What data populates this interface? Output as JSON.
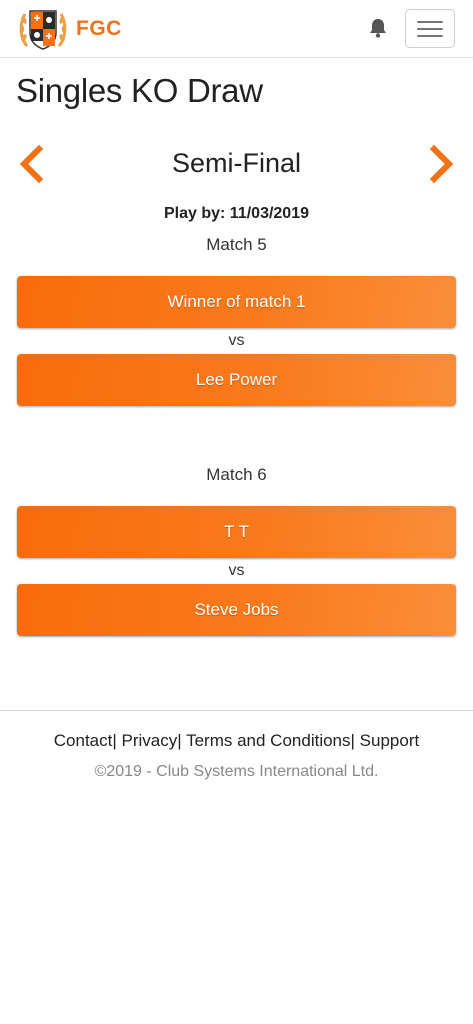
{
  "header": {
    "brand": "FGC",
    "notifications_icon": "bell-icon",
    "menu_icon": "hamburger-menu-icon"
  },
  "page": {
    "title": "Singles KO Draw"
  },
  "round": {
    "title": "Semi-Final",
    "prev_icon": "chevron-left-icon",
    "next_icon": "chevron-right-icon",
    "play_by": "Play by: 11/03/2019"
  },
  "matches": [
    {
      "label": "Match 5",
      "player1": "Winner of match 1",
      "vs": "vs",
      "player2": "Lee Power"
    },
    {
      "label": "Match 6",
      "player1": "T T",
      "vs": "vs",
      "player2": "Steve Jobs"
    }
  ],
  "footer": {
    "links": [
      "Contact",
      "Privacy",
      "Terms and Conditions",
      "Support"
    ],
    "separator": "|",
    "copyright": "©2019 - Club Systems International Ltd."
  },
  "colors": {
    "accent": "#f47216",
    "button": "#f97a1c"
  }
}
